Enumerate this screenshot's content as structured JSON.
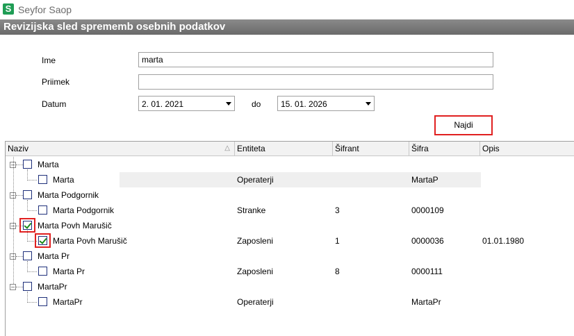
{
  "app": {
    "logo_letter": "S",
    "title": "Seyfor Saop"
  },
  "header": {
    "title": "Revizijska sled sprememb osebnih podatkov"
  },
  "form": {
    "ime_label": "Ime",
    "ime_value": "marta",
    "priimek_label": "Priimek",
    "priimek_value": "",
    "datum_label": "Datum",
    "date_from": "2. 01. 2021",
    "do_label": "do",
    "date_to": "15. 01. 2026",
    "search_label": "Najdi"
  },
  "grid": {
    "columns": [
      "Naziv",
      "Entiteta",
      "Šifrant",
      "Šifra",
      "Opis"
    ],
    "rows": [
      {
        "level": 0,
        "naziv": "Marta",
        "entiteta": "",
        "sifrant": "",
        "sifra": "",
        "opis": "",
        "checked": false
      },
      {
        "level": 1,
        "naziv": "Marta",
        "entiteta": "Operaterji",
        "sifrant": "",
        "sifra": "MartaP",
        "opis": "",
        "checked": false,
        "highlighted": true
      },
      {
        "level": 0,
        "naziv": "Marta Podgornik",
        "entiteta": "",
        "sifrant": "",
        "sifra": "",
        "opis": "",
        "checked": false
      },
      {
        "level": 1,
        "naziv": "Marta Podgornik",
        "entiteta": "Stranke",
        "sifrant": "3",
        "sifra": "0000109",
        "opis": "",
        "checked": false
      },
      {
        "level": 0,
        "naziv": "Marta Povh  Marušič",
        "entiteta": "",
        "sifrant": "",
        "sifra": "",
        "opis": "",
        "checked": true
      },
      {
        "level": 1,
        "naziv": "Marta Povh  Marušič",
        "entiteta": "Zaposleni",
        "sifrant": "1",
        "sifra": "0000036",
        "opis": "01.01.1980",
        "checked": true
      },
      {
        "level": 0,
        "naziv": "Marta Pr",
        "entiteta": "",
        "sifrant": "",
        "sifra": "",
        "opis": "",
        "checked": false
      },
      {
        "level": 1,
        "naziv": "Marta Pr",
        "entiteta": "Zaposleni",
        "sifrant": "8",
        "sifra": "0000111",
        "opis": "",
        "checked": false
      },
      {
        "level": 0,
        "naziv": "MartaPr",
        "entiteta": "",
        "sifrant": "",
        "sifra": "",
        "opis": "",
        "checked": false
      },
      {
        "level": 1,
        "naziv": "MartaPr",
        "entiteta": "Operaterji",
        "sifrant": "",
        "sifra": "MartaPr",
        "opis": "",
        "checked": false
      }
    ]
  },
  "icons": {
    "sort": "sort-asc-icon",
    "dropdown": "chevron-down-icon",
    "expander": "tree-collapse-icon",
    "check": "checkbox-check-icon"
  },
  "colors": {
    "accent_frame": "#e02020",
    "check": "#1a8a1a",
    "header_bar": "#7a7a7a"
  }
}
